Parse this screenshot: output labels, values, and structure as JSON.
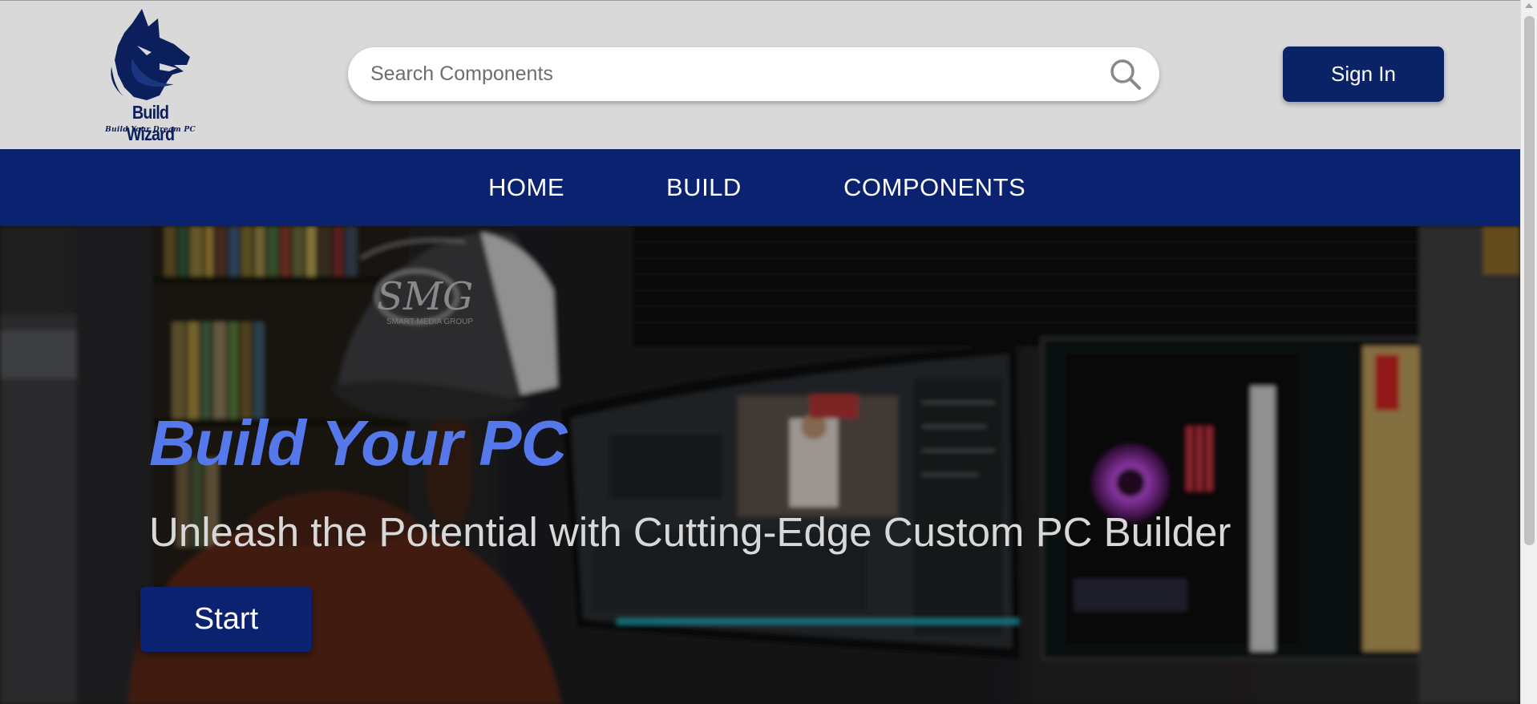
{
  "brand": {
    "name": "Build Wizard",
    "tagline": "Build Your Dream PC",
    "logo_icon": "wolf-head-icon",
    "color": "#0a1f5c"
  },
  "search": {
    "placeholder": "Search Components",
    "icon": "search-icon"
  },
  "header": {
    "signin_label": "Sign In"
  },
  "nav": {
    "items": [
      {
        "label": "HOME"
      },
      {
        "label": "BUILD"
      },
      {
        "label": "COMPONENTS"
      }
    ]
  },
  "hero": {
    "title": "Build Your PC",
    "subtitle": "Unleash the Potential with Cutting-Edge Custom PC Builder",
    "cta_label": "Start",
    "cap_logo": "SMG",
    "cap_sub": "SMART MEDIA GROUP"
  },
  "colors": {
    "nav_bg": "#0a2270",
    "header_bg": "#d9d9d9",
    "accent_title": "#5578ea"
  }
}
